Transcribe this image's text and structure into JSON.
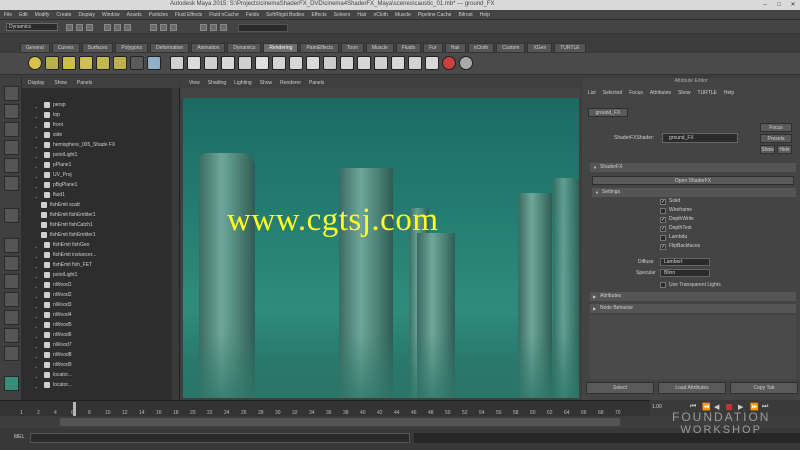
{
  "window": {
    "title": "Autodesk Maya 2015: S:\\Projects\\cinemaShaderFX_DVD\\cinema4ShaderFX_Maya\\scenes\\caustic_01.mb* --- ground_FX",
    "controls": [
      "–",
      "□",
      "✕"
    ]
  },
  "menubar": {
    "items": [
      "File",
      "Edit",
      "Modify",
      "Create",
      "Display",
      "Window",
      "Assets",
      "Particles",
      "Fluid Effects",
      "Fluid nCache",
      "Fields",
      "Soft/Rigid Bodies",
      "Effects",
      "Solvers",
      "Hair",
      "nCloth",
      "Muscle",
      "Pipeline Cache",
      "Bifrost",
      "Help"
    ]
  },
  "status_line": {
    "mode": "Dynamics"
  },
  "shelf": {
    "tabs": [
      "General",
      "Curves",
      "Surfaces",
      "Polygons",
      "Deformation",
      "Animation",
      "Dynamics",
      "Rendering",
      "PaintEffects",
      "Toon",
      "Muscle",
      "Fluids",
      "Fur",
      "Hair",
      "nCloth",
      "Custom",
      "XGen",
      "TURTLE"
    ],
    "selected_tab": "Rendering"
  },
  "outliner": {
    "menu": [
      "Display",
      "Show",
      "Panels"
    ],
    "rows": [
      {
        "label": "persp",
        "child": false
      },
      {
        "label": "top",
        "child": false
      },
      {
        "label": "front",
        "child": false
      },
      {
        "label": "side",
        "child": false
      },
      {
        "label": "hemisphere_005_Shade FX",
        "child": false
      },
      {
        "label": "pointLight1",
        "child": false
      },
      {
        "label": "pPlane1",
        "child": false
      },
      {
        "label": "UV_Proj",
        "child": false
      },
      {
        "label": "pBgPlane1",
        "child": false
      },
      {
        "label": "fluid1",
        "child": false
      },
      {
        "label": "fishEmit scatt",
        "child": true
      },
      {
        "label": "fishEmit fishEmitter1",
        "child": true
      },
      {
        "label": "fishEmit fishCatch1",
        "child": true
      },
      {
        "label": "fishEmit fishEmitter1",
        "child": true
      },
      {
        "label": "fishEmit fishGeo",
        "child": false
      },
      {
        "label": "fishEmit instancer...",
        "child": false
      },
      {
        "label": "fishEmit fish_FET",
        "child": false
      },
      {
        "label": "pointLight1",
        "child": false
      },
      {
        "label": "nWood1",
        "child": false
      },
      {
        "label": "nWood2",
        "child": false
      },
      {
        "label": "nWood3",
        "child": false
      },
      {
        "label": "nWood4",
        "child": false
      },
      {
        "label": "nWood5",
        "child": false
      },
      {
        "label": "nWood6",
        "child": false
      },
      {
        "label": "nWood7",
        "child": false
      },
      {
        "label": "nWood8",
        "child": false
      },
      {
        "label": "nWood9",
        "child": false
      },
      {
        "label": "locator...",
        "child": false
      },
      {
        "label": "locator...",
        "child": false
      }
    ]
  },
  "viewport": {
    "menu": [
      "View",
      "Shading",
      "Lighting",
      "Show",
      "Renderer",
      "Panels"
    ],
    "watermark": "www.cgtsj.com"
  },
  "attribute_editor": {
    "title": "Attribute Editor",
    "menu": [
      "List",
      "Selected",
      "Focus",
      "Attributes",
      "Show",
      "TURTLE",
      "Help"
    ],
    "node_tab": "ground_FX",
    "shaderfx_label": "ShaderFXShader:",
    "shaderfx_value": "ground_FX",
    "focus_btn": "Focus",
    "presets_btn": "Presets",
    "show_btn": "Show",
    "hide_btn": "Hide",
    "section_shaderfx": "ShaderFX",
    "open_btn": "Open ShaderFX",
    "section_settings": "Settings",
    "checkboxes": [
      {
        "label": "Solid",
        "checked": true
      },
      {
        "label": "Wireframe",
        "checked": false
      },
      {
        "label": "DepthWrite",
        "checked": true
      },
      {
        "label": "DepthTest",
        "checked": true
      },
      {
        "label": "Lambda",
        "checked": false
      },
      {
        "label": "FlipBackfaces",
        "checked": true
      }
    ],
    "diffuse_label": "Diffuse",
    "diffuse_value": "Lambert",
    "specular_label": "Specular",
    "specular_value": "Blinn",
    "extra_checkbox": "Use Transparent Lights",
    "section_attributes": "Attributes",
    "section_node": "Node Behavior",
    "bottom_buttons": [
      "Select",
      "Load Attributes",
      "Copy Tab"
    ]
  },
  "timeline": {
    "ticks": [
      "1",
      "2",
      "4",
      "6",
      "8",
      "10",
      "12",
      "14",
      "16",
      "18",
      "20",
      "22",
      "24",
      "26",
      "28",
      "30",
      "32",
      "34",
      "36",
      "38",
      "40",
      "42",
      "44",
      "46",
      "48",
      "50",
      "52",
      "54",
      "56",
      "58",
      "60",
      "62",
      "64",
      "66",
      "68",
      "70"
    ],
    "current_frame": "1.00"
  },
  "command_line": {
    "label": "MEL"
  },
  "brand": {
    "line1": "FOUNDATION",
    "line2": "WORKSHOP"
  },
  "colors": {
    "scene_water": "#237b6f",
    "watermark": "#ffff22"
  }
}
